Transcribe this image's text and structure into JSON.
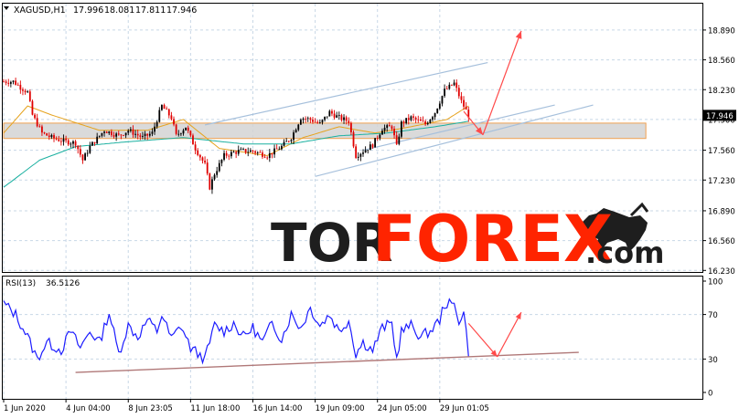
{
  "header": {
    "symbol_label": "XAGUSD,H1",
    "open": "17.996",
    "high": "18.081",
    "low": "17.811",
    "close": "17.946"
  },
  "rsi_header": {
    "label": "RSI(13)",
    "value": "36.5126"
  },
  "watermark": {
    "part1": "TOR",
    "part2": "FOREX",
    "part3": ".com"
  },
  "colors": {
    "background": "#ffffff",
    "grid": "#c8d7e6",
    "bull_candle": "#000000",
    "bear_candle": "#e00000",
    "ma_fast": "#e6a31e",
    "ma_slow": "#1ab0a0",
    "channel": "#a6c0dc",
    "zone_fill": "#d4d4d4",
    "zone_border": "#f0a050",
    "arrow": "#ff4a4a",
    "rsi_line": "#1c1cff",
    "rsi_trend": "#b07878",
    "watermark_dark": "#1e1e1e",
    "watermark_red": "#ff2400",
    "price_label_bg": "#000000"
  },
  "chart_data": [
    {
      "type": "candlestick",
      "title": "XAGUSD,H1",
      "y_ticks": [
        "18.890",
        "18.560",
        "18.230",
        "17.900",
        "17.560",
        "17.230",
        "16.890",
        "16.560",
        "16.230"
      ],
      "ylim": [
        16.21,
        19.22
      ],
      "current_price_label": "17.946",
      "x_ticks": [
        "1 Jun 2020",
        "4 Jun 04:00",
        "8 Jun 23:05",
        "11 Jun 18:00",
        "16 Jun 14:00",
        "19 Jun 09:00",
        "24 Jun 05:00",
        "29 Jun 01:05"
      ],
      "x_tick_index": [
        0,
        26,
        52,
        78,
        104,
        130,
        156,
        182
      ],
      "price_path": [
        {
          "i": 0,
          "p": 18.32
        },
        {
          "i": 4,
          "p": 18.32
        },
        {
          "i": 10,
          "p": 18.2
        },
        {
          "i": 12,
          "p": 17.95
        },
        {
          "i": 16,
          "p": 17.75
        },
        {
          "i": 20,
          "p": 17.7
        },
        {
          "i": 25,
          "p": 17.66
        },
        {
          "i": 30,
          "p": 17.64
        },
        {
          "i": 33,
          "p": 17.45
        },
        {
          "i": 36,
          "p": 17.6
        },
        {
          "i": 42,
          "p": 17.78
        },
        {
          "i": 48,
          "p": 17.72
        },
        {
          "i": 52,
          "p": 17.78
        },
        {
          "i": 58,
          "p": 17.7
        },
        {
          "i": 62,
          "p": 17.75
        },
        {
          "i": 66,
          "p": 18.05
        },
        {
          "i": 70,
          "p": 17.92
        },
        {
          "i": 72,
          "p": 17.72
        },
        {
          "i": 76,
          "p": 17.82
        },
        {
          "i": 80,
          "p": 17.58
        },
        {
          "i": 84,
          "p": 17.4
        },
        {
          "i": 86,
          "p": 17.15
        },
        {
          "i": 88,
          "p": 17.3
        },
        {
          "i": 92,
          "p": 17.5
        },
        {
          "i": 98,
          "p": 17.55
        },
        {
          "i": 104,
          "p": 17.55
        },
        {
          "i": 110,
          "p": 17.5
        },
        {
          "i": 116,
          "p": 17.6
        },
        {
          "i": 120,
          "p": 17.7
        },
        {
          "i": 124,
          "p": 17.92
        },
        {
          "i": 128,
          "p": 17.9
        },
        {
          "i": 132,
          "p": 17.85
        },
        {
          "i": 136,
          "p": 17.98
        },
        {
          "i": 140,
          "p": 17.92
        },
        {
          "i": 144,
          "p": 17.88
        },
        {
          "i": 147,
          "p": 17.5
        },
        {
          "i": 150,
          "p": 17.55
        },
        {
          "i": 154,
          "p": 17.62
        },
        {
          "i": 158,
          "p": 17.8
        },
        {
          "i": 162,
          "p": 17.82
        },
        {
          "i": 164,
          "p": 17.6
        },
        {
          "i": 166,
          "p": 17.86
        },
        {
          "i": 170,
          "p": 17.92
        },
        {
          "i": 176,
          "p": 17.85
        },
        {
          "i": 180,
          "p": 17.98
        },
        {
          "i": 184,
          "p": 18.22
        },
        {
          "i": 188,
          "p": 18.3
        },
        {
          "i": 191,
          "p": 18.1
        },
        {
          "i": 194,
          "p": 17.946
        }
      ],
      "candle_count": 195,
      "ma_fast_path": [
        {
          "i": 0,
          "p": 17.75
        },
        {
          "i": 10,
          "p": 18.05
        },
        {
          "i": 20,
          "p": 17.95
        },
        {
          "i": 40,
          "p": 17.78
        },
        {
          "i": 60,
          "p": 17.78
        },
        {
          "i": 75,
          "p": 17.9
        },
        {
          "i": 90,
          "p": 17.58
        },
        {
          "i": 110,
          "p": 17.5
        },
        {
          "i": 125,
          "p": 17.7
        },
        {
          "i": 140,
          "p": 17.82
        },
        {
          "i": 155,
          "p": 17.75
        },
        {
          "i": 170,
          "p": 17.82
        },
        {
          "i": 185,
          "p": 17.9
        },
        {
          "i": 194,
          "p": 18.05
        }
      ],
      "ma_slow_path": [
        {
          "i": 0,
          "p": 17.15
        },
        {
          "i": 15,
          "p": 17.45
        },
        {
          "i": 30,
          "p": 17.6
        },
        {
          "i": 50,
          "p": 17.65
        },
        {
          "i": 75,
          "p": 17.7
        },
        {
          "i": 100,
          "p": 17.63
        },
        {
          "i": 120,
          "p": 17.63
        },
        {
          "i": 140,
          "p": 17.72
        },
        {
          "i": 160,
          "p": 17.75
        },
        {
          "i": 180,
          "p": 17.82
        },
        {
          "i": 194,
          "p": 17.88
        }
      ],
      "annotations": {
        "channel_upper": [
          {
            "i": 84,
            "p": 17.84
          },
          {
            "i": 202,
            "p": 18.53
          }
        ],
        "channel_mid": [
          {
            "i": 150,
            "p": 17.56
          },
          {
            "i": 230,
            "p": 18.06
          }
        ],
        "channel_lower": [
          {
            "i": 130,
            "p": 17.27
          },
          {
            "i": 246,
            "p": 18.06
          }
        ],
        "support_zone": {
          "i_start": 0,
          "i_end": 268,
          "p_top": 17.86,
          "p_bottom": 17.69
        },
        "arrow_down": {
          "from": {
            "i": 192,
            "p": 17.99
          },
          "to": {
            "i": 200,
            "p": 17.73
          }
        },
        "arrow_up": {
          "from": {
            "i": 200,
            "p": 17.73
          },
          "to": {
            "i": 216,
            "p": 18.88
          }
        }
      }
    },
    {
      "type": "line",
      "title": "RSI(13) 36.5126",
      "y_ticks": [
        "100",
        "70",
        "30",
        "0"
      ],
      "ylim": [
        0,
        100
      ],
      "values_path": [
        {
          "i": 0,
          "v": 80
        },
        {
          "i": 5,
          "v": 70
        },
        {
          "i": 10,
          "v": 50
        },
        {
          "i": 14,
          "v": 30
        },
        {
          "i": 18,
          "v": 45
        },
        {
          "i": 24,
          "v": 38
        },
        {
          "i": 28,
          "v": 55
        },
        {
          "i": 32,
          "v": 40
        },
        {
          "i": 36,
          "v": 55
        },
        {
          "i": 40,
          "v": 45
        },
        {
          "i": 44,
          "v": 72
        },
        {
          "i": 48,
          "v": 35
        },
        {
          "i": 52,
          "v": 60
        },
        {
          "i": 56,
          "v": 50
        },
        {
          "i": 60,
          "v": 65
        },
        {
          "i": 64,
          "v": 55
        },
        {
          "i": 66,
          "v": 70
        },
        {
          "i": 70,
          "v": 48
        },
        {
          "i": 74,
          "v": 60
        },
        {
          "i": 78,
          "v": 40
        },
        {
          "i": 84,
          "v": 30
        },
        {
          "i": 88,
          "v": 60
        },
        {
          "i": 92,
          "v": 55
        },
        {
          "i": 96,
          "v": 62
        },
        {
          "i": 100,
          "v": 50
        },
        {
          "i": 104,
          "v": 58
        },
        {
          "i": 108,
          "v": 45
        },
        {
          "i": 112,
          "v": 62
        },
        {
          "i": 116,
          "v": 48
        },
        {
          "i": 120,
          "v": 70
        },
        {
          "i": 124,
          "v": 58
        },
        {
          "i": 128,
          "v": 76
        },
        {
          "i": 132,
          "v": 60
        },
        {
          "i": 136,
          "v": 70
        },
        {
          "i": 140,
          "v": 55
        },
        {
          "i": 144,
          "v": 65
        },
        {
          "i": 147,
          "v": 35
        },
        {
          "i": 150,
          "v": 45
        },
        {
          "i": 154,
          "v": 38
        },
        {
          "i": 158,
          "v": 58
        },
        {
          "i": 162,
          "v": 62
        },
        {
          "i": 164,
          "v": 30
        },
        {
          "i": 166,
          "v": 55
        },
        {
          "i": 170,
          "v": 60
        },
        {
          "i": 174,
          "v": 50
        },
        {
          "i": 178,
          "v": 55
        },
        {
          "i": 182,
          "v": 65
        },
        {
          "i": 184,
          "v": 80
        },
        {
          "i": 188,
          "v": 78
        },
        {
          "i": 190,
          "v": 65
        },
        {
          "i": 192,
          "v": 72
        },
        {
          "i": 194,
          "v": 36.5
        }
      ],
      "annotations": {
        "trendline": [
          {
            "i": 30,
            "v": 18
          },
          {
            "i": 240,
            "v": 36
          }
        ],
        "arrow_down": {
          "from": {
            "i": 194,
            "v": 62
          },
          "to": {
            "i": 206,
            "v": 32
          }
        },
        "arrow_up": {
          "from": {
            "i": 206,
            "v": 32
          },
          "to": {
            "i": 216,
            "v": 72
          }
        }
      }
    }
  ]
}
